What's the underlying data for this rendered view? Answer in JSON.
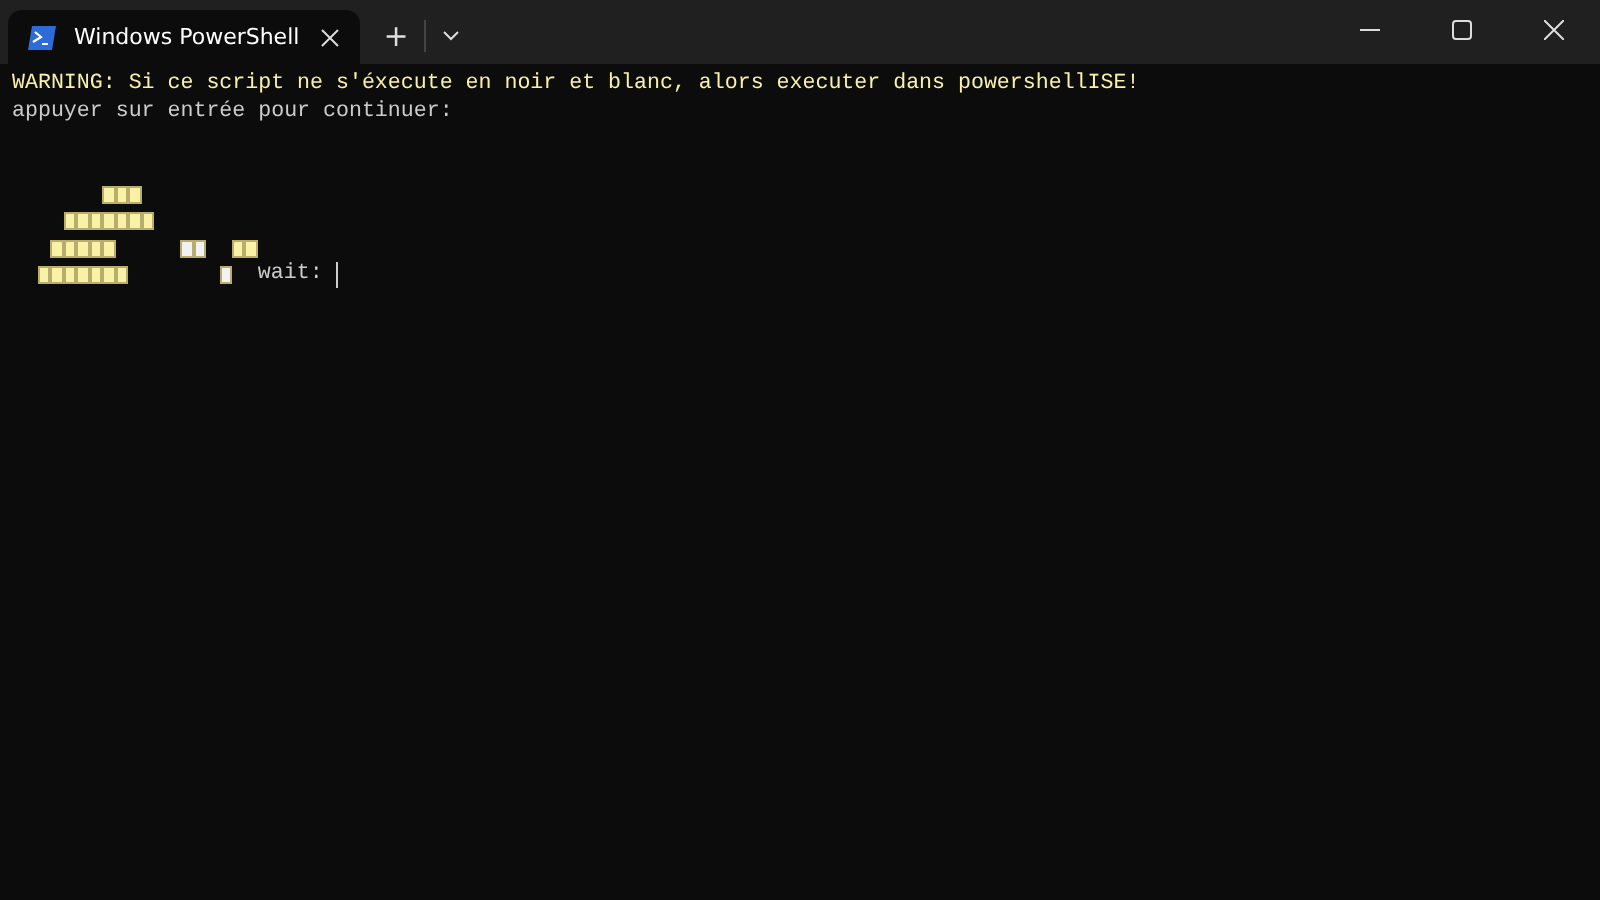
{
  "window": {
    "tabs": [
      {
        "title": "Windows PowerShell",
        "selected": true
      }
    ],
    "new_tab": "+"
  },
  "terminal": {
    "lines": [
      {
        "kind": "text",
        "text": "WARNING: Si ce script ne s'éxecute en noir et blanc, alors executer dans powershellISE!",
        "color": "#f9f1a5"
      },
      {
        "kind": "text",
        "text": "appuyer sur entrée pour continuer:",
        "color": "#cccccc"
      },
      {
        "kind": "blank"
      },
      {
        "kind": "blank"
      },
      {
        "kind": "art",
        "cells": [
          {
            "kind": "blank"
          },
          {
            "kind": "blank"
          },
          {
            "kind": "blank"
          },
          {
            "kind": "blank"
          },
          {
            "kind": "blank"
          },
          {
            "kind": "blank"
          },
          {
            "kind": "blank"
          },
          {
            "kind": "cell",
            "color": "#f9f1a5"
          },
          {
            "kind": "cell",
            "color": "#f9f1a5"
          },
          {
            "kind": "cell",
            "color": "#f9f1a5"
          }
        ]
      },
      {
        "kind": "art",
        "cells": [
          {
            "kind": "blank"
          },
          {
            "kind": "blank"
          },
          {
            "kind": "blank"
          },
          {
            "kind": "blank"
          },
          {
            "kind": "cell",
            "color": "#f9f1a5"
          },
          {
            "kind": "cell",
            "color": "#f9f1a5"
          },
          {
            "kind": "cell",
            "color": "#f9f1a5"
          },
          {
            "kind": "cell",
            "color": "#f9f1a5"
          },
          {
            "kind": "cell",
            "color": "#f9f1a5"
          },
          {
            "kind": "cell",
            "color": "#f9f1a5"
          },
          {
            "kind": "cell",
            "color": "#f9f1a5"
          }
        ]
      },
      {
        "kind": "art",
        "cells": [
          {
            "kind": "blank"
          },
          {
            "kind": "blank"
          },
          {
            "kind": "blank"
          },
          {
            "kind": "cell",
            "color": "#f9f1a5"
          },
          {
            "kind": "cell",
            "color": "#f9f1a5"
          },
          {
            "kind": "cell",
            "color": "#f9f1a5"
          },
          {
            "kind": "cell",
            "color": "#f9f1a5"
          },
          {
            "kind": "cell",
            "color": "#f9f1a5"
          },
          {
            "kind": "blank"
          },
          {
            "kind": "blank"
          },
          {
            "kind": "blank"
          },
          {
            "kind": "blank"
          },
          {
            "kind": "blank"
          },
          {
            "kind": "cell",
            "color": "#f2f2f2"
          },
          {
            "kind": "cell",
            "color": "#f2f2f2"
          },
          {
            "kind": "blank"
          },
          {
            "kind": "blank"
          },
          {
            "kind": "cell",
            "color": "#f9f1a5"
          },
          {
            "kind": "cell",
            "color": "#f9f1a5"
          }
        ]
      },
      {
        "kind": "art",
        "cells": [
          {
            "kind": "blank"
          },
          {
            "kind": "blank"
          },
          {
            "kind": "cell",
            "color": "#f9f1a5"
          },
          {
            "kind": "cell",
            "color": "#f9f1a5"
          },
          {
            "kind": "cell",
            "color": "#f9f1a5"
          },
          {
            "kind": "cell",
            "color": "#f9f1a5"
          },
          {
            "kind": "cell",
            "color": "#f9f1a5"
          },
          {
            "kind": "cell",
            "color": "#f9f1a5"
          },
          {
            "kind": "cell",
            "color": "#f9f1a5"
          },
          {
            "kind": "blank"
          },
          {
            "kind": "blank"
          },
          {
            "kind": "blank"
          },
          {
            "kind": "blank"
          },
          {
            "kind": "blank"
          },
          {
            "kind": "blank"
          },
          {
            "kind": "blank"
          },
          {
            "kind": "cell",
            "color": "#f2f2f2"
          },
          {
            "kind": "blank"
          }
        ],
        "prompt": "wait:"
      }
    ]
  }
}
